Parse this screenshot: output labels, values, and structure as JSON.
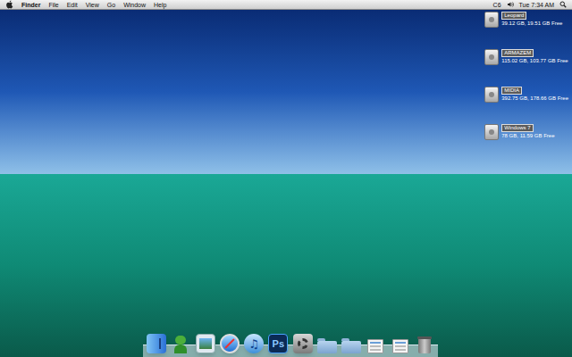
{
  "menu_bar": {
    "app": "Finder",
    "menus": [
      "File",
      "Edit",
      "View",
      "Go",
      "Window",
      "Help"
    ],
    "status": "C6",
    "clock": "Tue 7:34 AM"
  },
  "desktop_icons": [
    {
      "name": "Leopard",
      "info": "39.12 GB, 19.51 GB Free"
    },
    {
      "name": "ARMAZEM",
      "info": "115.02 GB, 103.77 GB Free"
    },
    {
      "name": "MIDIA",
      "info": "392.75 GB, 178.66 GB Free"
    },
    {
      "name": "Windows 7",
      "info": "78 GB, 11.59 GB Free"
    }
  ],
  "dock": {
    "items": [
      {
        "kind": "finder",
        "text": ""
      },
      {
        "kind": "character",
        "text": ""
      },
      {
        "kind": "photos",
        "text": ""
      },
      {
        "kind": "safari",
        "text": ""
      },
      {
        "kind": "music",
        "text": ""
      },
      {
        "kind": "photoshop",
        "text": "Ps"
      },
      {
        "kind": "preferences",
        "text": ""
      },
      {
        "kind": "folder",
        "text": ""
      },
      {
        "kind": "folder",
        "text": ""
      },
      {
        "kind": "document",
        "text": ""
      },
      {
        "kind": "document",
        "text": ""
      },
      {
        "kind": "trash",
        "text": ""
      }
    ]
  }
}
